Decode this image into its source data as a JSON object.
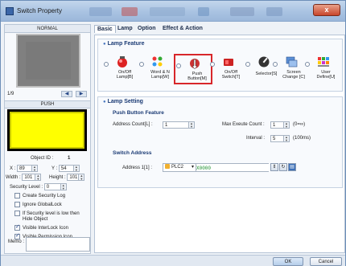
{
  "window": {
    "title": "Switch Property",
    "close_label": "x"
  },
  "left": {
    "normal_label": "NORMAL",
    "push_label": "PUSH",
    "page_number": "1/9",
    "prev_label": "◀",
    "next_label": "▶",
    "object_id_label": "Object ID :",
    "object_id_value": "1",
    "x_label": "X :",
    "x_value": "89",
    "y_label": "Y :",
    "y_value": "54",
    "width_label": "Width :",
    "width_value": "101",
    "height_label": "Height :",
    "height_value": "101",
    "security_label": "Security Level :",
    "security_value": "0",
    "checkboxes": [
      {
        "label": "Create Security Log",
        "checked": false
      },
      {
        "label": "Ignore GlobalLock",
        "checked": false
      },
      {
        "label": "If Security level is low then",
        "label2": "Hide Object",
        "checked": false
      },
      {
        "label": "Visible InterLock Icon",
        "checked": true
      },
      {
        "label": "Visible Permission Icon",
        "checked": true
      }
    ],
    "memo_label": "Memo :"
  },
  "tabs": [
    "Basic",
    "Lamp",
    "Option",
    "Effect & Action"
  ],
  "lamp_feature": {
    "title": "Lamp Feature",
    "items": [
      {
        "line1": "On/Off",
        "line2": "Lamp[B]"
      },
      {
        "line1": "Word & N",
        "line2": "Lamp[W]"
      },
      {
        "line1": "Push",
        "line2": "Button[M]"
      },
      {
        "line1": "On/Off",
        "line2": "Switch[T]"
      },
      {
        "line1": "Selector[S]",
        "line2": ""
      },
      {
        "line1": "Screen",
        "line2": "Change [C]"
      },
      {
        "line1": "User",
        "line2": "Define[U]"
      }
    ]
  },
  "lamp_setting": {
    "title": "Lamp Setting",
    "push_feature_title": "Push Button Feature",
    "address_count_label": "Address Count[L] :",
    "address_count_value": "1",
    "max_execute_label": "Max Exeute Count :",
    "max_execute_value": "1",
    "max_execute_hint": "(0=∞)",
    "interval_label": "Interval :",
    "interval_value": "5",
    "interval_hint": "(100ms)",
    "switch_address_title": "Switch Address",
    "address_label": "Address 1[1] :",
    "plc_value": "PLC2",
    "address_value": "X0000"
  },
  "buttons": {
    "ok": "OK",
    "cancel": "Cancel"
  }
}
